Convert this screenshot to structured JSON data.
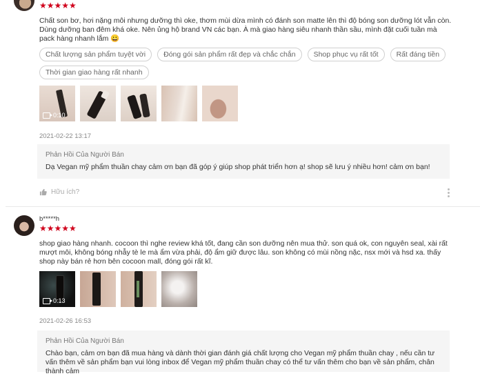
{
  "reviews": [
    {
      "username": "",
      "stars": "★★★★★",
      "text": "Chất son bơ, hơi nặng môi nhưng dưỡng thì oke, thơm mùi dừa mình có đánh son matte lên thì độ bóng son dưỡng lót vẫn còn. Dùng dưỡng ban đêm khá oke. Nên ủng hộ brand VN các bạn. À mà giao hàng siêu nhanh thần sầu, mình đặt cuối tuần mà pack hàng nhanh lắm 😀",
      "tags": [
        "Chất lượng sản phẩm tuyệt vời",
        "Đóng gói sản phẩm rất đẹp và chắc chắn",
        "Shop phục vụ rất tốt",
        "Rất đáng tiền",
        "Thời gian giao hàng rất nhanh"
      ],
      "video_duration": "0:10",
      "date": "2021-02-22 13:17",
      "reply_title": "Phản Hồi Của Người Bán",
      "reply_text": "Dạ Vegan mỹ phẩm thuần chay cảm ơn bạn đã góp ý giúp shop phát triển hơn ạ! shop sẽ lưu ý nhiều hơn! cảm ơn bạn!",
      "helpful": "Hữu ích?"
    },
    {
      "username": "b*****h",
      "stars": "★★★★★",
      "text": "shop giao hàng nhanh. cocoon thì nghe review khá tốt, đang cần son dưỡng nên mua thử. son quá ok, con nguyên seal, xài rất mượt môi, không bóng nhẫy tè le mà ẩm vừa phải, độ ẩm giữ được lâu. son không có mùi nồng nặc, nsx mới và hsd xa. thấy shop này bán rẻ hơn bên cocoon mall, đóng gói rất kĩ.",
      "video_duration": "0:13",
      "date": "2021-02-26 16:53",
      "reply_title": "Phản Hồi Của Người Bán",
      "reply_text": "Chào bạn, cảm ơn bạn đã mua hàng và dành thời gian đánh giá chất lượng cho Vegan mỹ phẩm thuần chay , nếu cần tư vấn thêm về sản phẩm bạn vui lòng inbox để Vegan mỹ phẩm thuần chay có thể tư vấn thêm cho bạn về sản phẩm, chân thành cảm"
    }
  ]
}
